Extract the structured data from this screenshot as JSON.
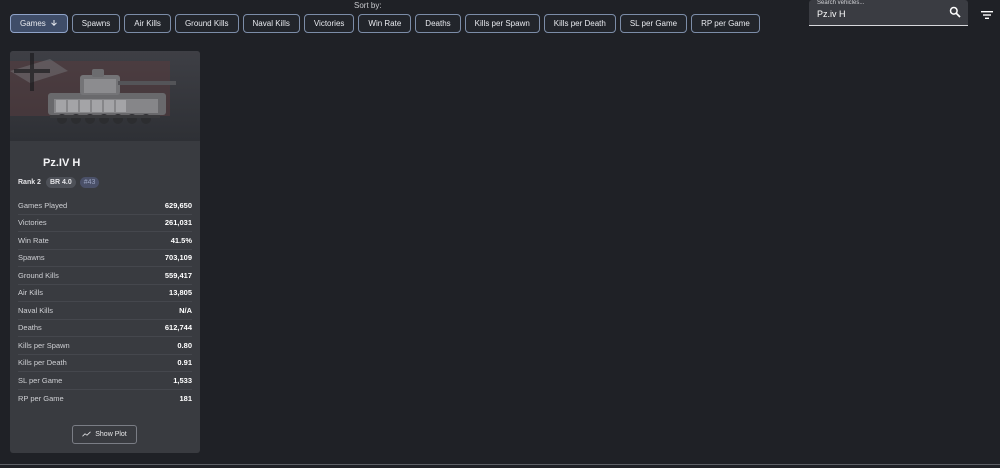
{
  "sort": {
    "label": "Sort by:",
    "options": [
      {
        "label": "Games",
        "active": true,
        "direction_icon": "arrow-down-icon"
      },
      {
        "label": "Spawns"
      },
      {
        "label": "Air Kills"
      },
      {
        "label": "Ground Kills"
      },
      {
        "label": "Naval Kills"
      },
      {
        "label": "Victories"
      },
      {
        "label": "Win Rate"
      },
      {
        "label": "Deaths"
      },
      {
        "label": "Kills per Spawn"
      },
      {
        "label": "Kills per Death"
      },
      {
        "label": "SL per Game"
      },
      {
        "label": "RP per Game"
      }
    ]
  },
  "search": {
    "label": "Search vehicles...",
    "value": "Pz.iv H",
    "icon": "search-icon"
  },
  "filter": {
    "icon": "filter-icon"
  },
  "vehicle": {
    "name": "Pz.IV H",
    "rank": "Rank 2",
    "br": "BR 4.0",
    "position": "#43",
    "stats": [
      {
        "label": "Games Played",
        "value": "629,650"
      },
      {
        "label": "Victories",
        "value": "261,031"
      },
      {
        "label": "Win Rate",
        "value": "41.5%"
      },
      {
        "label": "Spawns",
        "value": "703,109"
      },
      {
        "label": "Ground Kills",
        "value": "559,417"
      },
      {
        "label": "Air Kills",
        "value": "13,805"
      },
      {
        "label": "Naval Kills",
        "value": "N/A"
      },
      {
        "label": "Deaths",
        "value": "612,744"
      },
      {
        "label": "Kills per Spawn",
        "value": "0.80"
      },
      {
        "label": "Kills per Death",
        "value": "0.91"
      },
      {
        "label": "SL per Game",
        "value": "1,533"
      },
      {
        "label": "RP per Game",
        "value": "181"
      }
    ],
    "show_plot_label": "Show Plot",
    "show_plot_icon": "trending-line-icon"
  },
  "colors": {
    "background": "#1f2126",
    "card": "#393b40",
    "chip_border": "#7c8da8",
    "chip_active": "#3f4d68"
  }
}
